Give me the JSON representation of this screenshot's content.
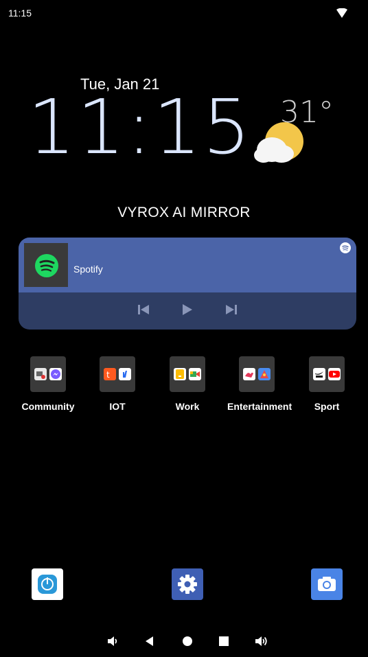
{
  "status": {
    "time": "11:15",
    "wifi_icon": "wifi-icon"
  },
  "lock": {
    "date": "Tue, Jan 21",
    "time": "11:15",
    "temperature": "31°",
    "weather_icon": "partly-cloudy-icon",
    "brand": "VYROX AI MIRROR"
  },
  "media": {
    "app": "Spotify",
    "controls": [
      "previous-icon",
      "play-icon",
      "next-icon"
    ]
  },
  "folders": [
    {
      "label": "Community",
      "icons": [
        "gmail-icon",
        "messenger-icon"
      ]
    },
    {
      "label": "IOT",
      "icons": [
        "tuya-icon",
        "smart-home-icon"
      ]
    },
    {
      "label": "Work",
      "icons": [
        "keep-icon",
        "meet-icon"
      ]
    },
    {
      "label": "Entertainment",
      "icons": [
        "music-icon",
        "game-icon"
      ]
    },
    {
      "label": "Sport",
      "icons": [
        "nike-run-club-icon",
        "youtube-icon"
      ]
    }
  ],
  "dock": [
    "power-app-icon",
    "settings-icon",
    "camera-icon"
  ],
  "navbar": [
    "volume-down-icon",
    "back-icon",
    "home-icon",
    "recents-icon",
    "volume-up-icon"
  ],
  "colors": {
    "clock": "#dbe6ff",
    "media_top": "#4b64a8",
    "media_bottom": "#2e3d63",
    "spotify_green": "#1ed760"
  }
}
